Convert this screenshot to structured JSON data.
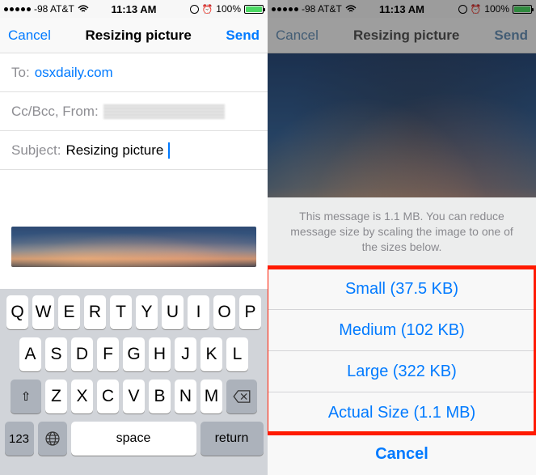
{
  "status": {
    "carrier": "-98 AT&T",
    "wifi_icon": "wifi-icon",
    "time": "11:13 AM",
    "battery_pct": "100%",
    "alarm": "⏰",
    "lock_rot": "↻"
  },
  "left": {
    "nav": {
      "cancel": "Cancel",
      "title": "Resizing picture",
      "send": "Send"
    },
    "fields": {
      "to_label": "To:",
      "to_value": "osxdaily.com",
      "ccbcc_label": "Cc/Bcc, From:",
      "subject_label": "Subject:",
      "subject_value": "Resizing picture"
    },
    "keyboard": {
      "row1": [
        "Q",
        "W",
        "E",
        "R",
        "T",
        "Y",
        "U",
        "I",
        "O",
        "P"
      ],
      "row2": [
        "A",
        "S",
        "D",
        "F",
        "G",
        "H",
        "J",
        "K",
        "L"
      ],
      "row3": [
        "Z",
        "X",
        "C",
        "V",
        "B",
        "N",
        "M"
      ],
      "shift": "⇧",
      "delete": "⌫",
      "num": "123",
      "globe": "🌐",
      "space": "space",
      "return": "return"
    }
  },
  "right": {
    "nav": {
      "cancel": "Cancel",
      "title": "Resizing picture",
      "send": "Send"
    },
    "sheet": {
      "message": "This message is 1.1 MB. You can reduce message size by scaling the image to one of the sizes below.",
      "options": [
        "Small (37.5 KB)",
        "Medium (102 KB)",
        "Large (322 KB)",
        "Actual Size (1.1 MB)"
      ],
      "cancel": "Cancel"
    }
  }
}
